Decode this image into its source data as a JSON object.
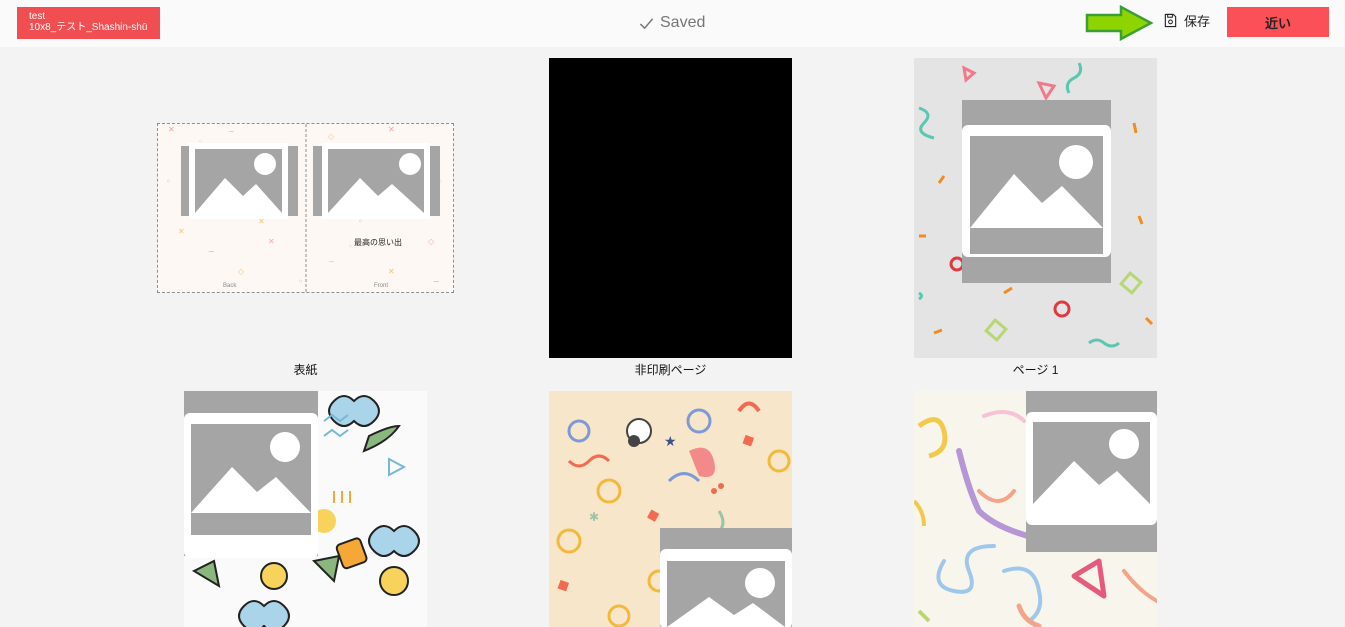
{
  "header": {
    "project_name_line1": "test",
    "project_name_line2": "10x8_テスト_Shashin-shū",
    "saved_status": "Saved",
    "save_label": "保存",
    "close_label": "近い",
    "colors": {
      "badge": "#f04e51",
      "close": "#fb5057",
      "arrow": "#8ed400"
    }
  },
  "pages": [
    {
      "caption": "表紙",
      "cover_title": "最高の思い出",
      "back_label": "Back",
      "front_label": "Front"
    },
    {
      "caption": "非印刷ページ"
    },
    {
      "caption": "ページ 1"
    },
    {
      "caption": ""
    },
    {
      "caption": ""
    },
    {
      "caption": ""
    }
  ],
  "icons": [
    "check-icon",
    "save-file-icon",
    "image-placeholder-icon",
    "arrow-pointer-icon"
  ]
}
